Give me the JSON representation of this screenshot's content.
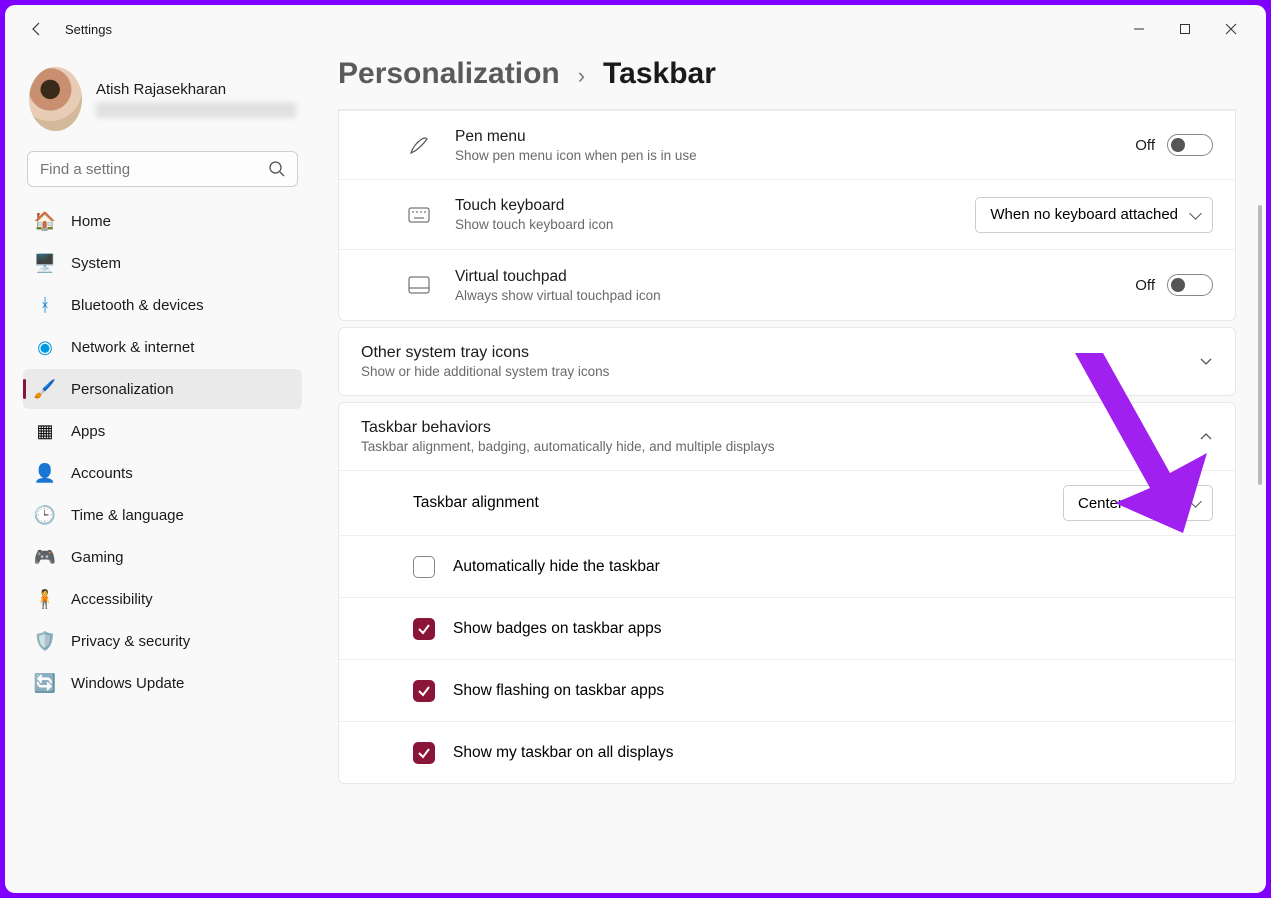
{
  "app_title": "Settings",
  "profile": {
    "name": "Atish Rajasekharan"
  },
  "search": {
    "placeholder": "Find a setting"
  },
  "nav": [
    {
      "id": "home",
      "label": "Home"
    },
    {
      "id": "system",
      "label": "System"
    },
    {
      "id": "bluetooth",
      "label": "Bluetooth & devices"
    },
    {
      "id": "network",
      "label": "Network & internet"
    },
    {
      "id": "personalization",
      "label": "Personalization",
      "active": true
    },
    {
      "id": "apps",
      "label": "Apps"
    },
    {
      "id": "accounts",
      "label": "Accounts"
    },
    {
      "id": "time",
      "label": "Time & language"
    },
    {
      "id": "gaming",
      "label": "Gaming"
    },
    {
      "id": "accessibility",
      "label": "Accessibility"
    },
    {
      "id": "privacy",
      "label": "Privacy & security"
    },
    {
      "id": "update",
      "label": "Windows Update"
    }
  ],
  "breadcrumb": {
    "parent": "Personalization",
    "current": "Taskbar"
  },
  "rows": {
    "pen": {
      "title": "Pen menu",
      "sub": "Show pen menu icon when pen is in use",
      "state": "Off"
    },
    "touch": {
      "title": "Touch keyboard",
      "sub": "Show touch keyboard icon",
      "value": "When no keyboard attached"
    },
    "vtouch": {
      "title": "Virtual touchpad",
      "sub": "Always show virtual touchpad icon",
      "state": "Off"
    }
  },
  "tray": {
    "title": "Other system tray icons",
    "sub": "Show or hide additional system tray icons"
  },
  "behaviors": {
    "title": "Taskbar behaviors",
    "sub": "Taskbar alignment, badging, automatically hide, and multiple displays",
    "alignment_label": "Taskbar alignment",
    "alignment_value": "Center",
    "autohide": "Automatically hide the taskbar",
    "badges": "Show badges on taskbar apps",
    "flashing": "Show flashing on taskbar apps",
    "alldisplays": "Show my taskbar on all displays"
  }
}
